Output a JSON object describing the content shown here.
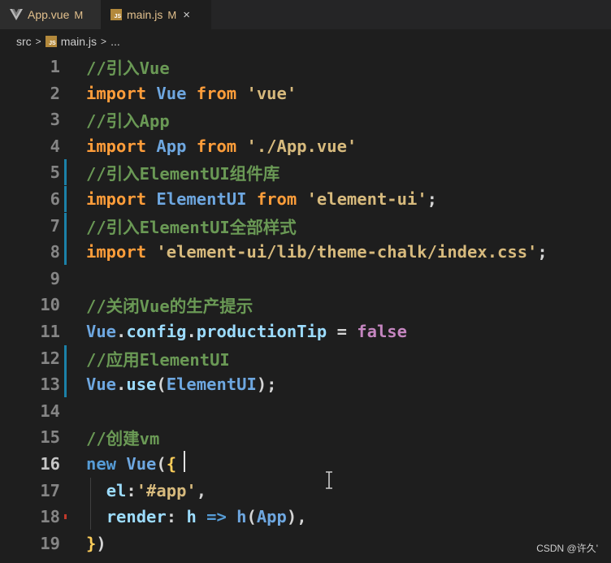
{
  "tabs": [
    {
      "name": "App.vue",
      "status": "M",
      "icon": "vue-icon"
    },
    {
      "name": "main.js",
      "status": "M",
      "icon": "js-icon",
      "close": "×"
    }
  ],
  "breadcrumb": {
    "folder": "src",
    "file": "main.js",
    "more": "..."
  },
  "colors": {
    "keyword_import": "#ff9d3a",
    "string": "#d7ba7d",
    "comment": "#6a9955",
    "number": "#858585"
  },
  "lines": [
    {
      "n": "1",
      "tokens": [
        {
          "c": "cm",
          "t": "//引入Vue"
        }
      ]
    },
    {
      "n": "2",
      "tokens": [
        {
          "c": "kw-i",
          "t": "import"
        },
        {
          "c": "pn",
          "t": " "
        },
        {
          "c": "ident",
          "t": "Vue"
        },
        {
          "c": "pn",
          "t": " "
        },
        {
          "c": "kw-i",
          "t": "from"
        },
        {
          "c": "pn",
          "t": " "
        },
        {
          "c": "str",
          "t": "'vue'"
        }
      ]
    },
    {
      "n": "3",
      "tokens": [
        {
          "c": "cm",
          "t": "//引入App"
        }
      ]
    },
    {
      "n": "4",
      "tokens": [
        {
          "c": "kw-i",
          "t": "import"
        },
        {
          "c": "pn",
          "t": " "
        },
        {
          "c": "ident",
          "t": "App"
        },
        {
          "c": "pn",
          "t": " "
        },
        {
          "c": "kw-i",
          "t": "from"
        },
        {
          "c": "pn",
          "t": " "
        },
        {
          "c": "str",
          "t": "'./App.vue'"
        }
      ]
    },
    {
      "n": "5",
      "mod": true,
      "tokens": [
        {
          "c": "cm",
          "t": "//引入ElementUI组件库"
        }
      ]
    },
    {
      "n": "6",
      "mod": true,
      "tokens": [
        {
          "c": "kw-i",
          "t": "import"
        },
        {
          "c": "pn",
          "t": " "
        },
        {
          "c": "ident",
          "t": "ElementUI"
        },
        {
          "c": "pn",
          "t": " "
        },
        {
          "c": "kw-i",
          "t": "from"
        },
        {
          "c": "pn",
          "t": " "
        },
        {
          "c": "str",
          "t": "'element-ui'"
        },
        {
          "c": "pn",
          "t": ";"
        }
      ]
    },
    {
      "n": "7",
      "mod": true,
      "tokens": [
        {
          "c": "cm",
          "t": "//引入ElementUI全部样式"
        }
      ]
    },
    {
      "n": "8",
      "mod": true,
      "tokens": [
        {
          "c": "kw-i",
          "t": "import"
        },
        {
          "c": "pn",
          "t": " "
        },
        {
          "c": "str",
          "t": "'element-ui/lib/theme-chalk/index.css'"
        },
        {
          "c": "pn",
          "t": ";"
        }
      ]
    },
    {
      "n": "9",
      "tokens": []
    },
    {
      "n": "10",
      "tokens": [
        {
          "c": "cm",
          "t": "//关闭Vue的生产提示"
        }
      ]
    },
    {
      "n": "11",
      "tokens": [
        {
          "c": "ident",
          "t": "Vue"
        },
        {
          "c": "pn",
          "t": "."
        },
        {
          "c": "id",
          "t": "config"
        },
        {
          "c": "pn",
          "t": "."
        },
        {
          "c": "id",
          "t": "productionTip"
        },
        {
          "c": "pn",
          "t": " = "
        },
        {
          "c": "bool",
          "t": "false"
        }
      ]
    },
    {
      "n": "12",
      "mod": true,
      "tokens": [
        {
          "c": "cm",
          "t": "//应用ElementUI"
        }
      ]
    },
    {
      "n": "13",
      "mod": true,
      "tokens": [
        {
          "c": "ident",
          "t": "Vue"
        },
        {
          "c": "pn",
          "t": "."
        },
        {
          "c": "id",
          "t": "use"
        },
        {
          "c": "pn",
          "t": "("
        },
        {
          "c": "ident",
          "t": "ElementUI"
        },
        {
          "c": "pn",
          "t": ");"
        }
      ]
    },
    {
      "n": "14",
      "tokens": []
    },
    {
      "n": "15",
      "tokens": [
        {
          "c": "cm",
          "t": "//创建vm"
        }
      ]
    },
    {
      "n": "16",
      "current": true,
      "tokens": [
        {
          "c": "kw",
          "t": "new"
        },
        {
          "c": "pn",
          "t": " "
        },
        {
          "c": "ident",
          "t": "Vue"
        },
        {
          "c": "pn",
          "t": "("
        },
        {
          "c": "op",
          "t": "{"
        }
      ]
    },
    {
      "n": "17",
      "tokens": [
        {
          "c": "pn",
          "t": "  "
        },
        {
          "c": "id",
          "t": "el"
        },
        {
          "c": "pn",
          "t": ":"
        },
        {
          "c": "str",
          "t": "'#app'"
        },
        {
          "c": "pn",
          "t": ","
        }
      ]
    },
    {
      "n": "18",
      "err": true,
      "tokens": [
        {
          "c": "pn",
          "t": "  "
        },
        {
          "c": "id",
          "t": "render"
        },
        {
          "c": "pn",
          "t": ": "
        },
        {
          "c": "id",
          "t": "h"
        },
        {
          "c": "pn",
          "t": " "
        },
        {
          "c": "kw",
          "t": "=>"
        },
        {
          "c": "pn",
          "t": " "
        },
        {
          "c": "ident",
          "t": "h"
        },
        {
          "c": "pn",
          "t": "("
        },
        {
          "c": "ident",
          "t": "App"
        },
        {
          "c": "pn",
          "t": "),"
        }
      ]
    },
    {
      "n": "19",
      "tokens": [
        {
          "c": "op",
          "t": "}"
        },
        {
          "c": "pn",
          "t": ")"
        }
      ]
    }
  ],
  "watermark": "CSDN @许久'"
}
